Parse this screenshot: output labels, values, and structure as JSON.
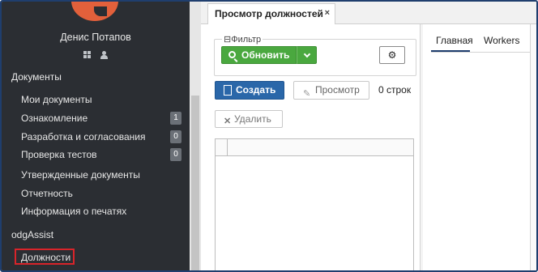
{
  "sidebar": {
    "user_name": "Денис Потапов",
    "icons": [
      "grid-icon",
      "person-icon"
    ],
    "documents_title": "Документы",
    "items": [
      {
        "label": "Мои документы",
        "badge": ""
      },
      {
        "label": "Ознакомление",
        "badge": "1"
      },
      {
        "label": "Разработка и согласования",
        "badge": "0"
      },
      {
        "label": "Проверка тестов",
        "badge": "0"
      },
      {
        "label": "Утвержденные документы",
        "badge": ""
      },
      {
        "label": "Отчетность",
        "badge": ""
      },
      {
        "label": "Информация о печатях",
        "badge": ""
      }
    ],
    "odg_title": "odgAssist",
    "odg_items": [
      {
        "label": "Должности",
        "highlighted": true
      }
    ]
  },
  "tabs": {
    "active_label": "Просмотр должностей",
    "close_glyph": "×"
  },
  "filter": {
    "legend": "Фильтр",
    "collapse_glyph": "⊟",
    "refresh_label": "Обновить",
    "settings_glyph": "⚙"
  },
  "toolbar": {
    "create_label": "Создать",
    "view_label": "Просмотр",
    "count_text": "0 строк",
    "delete_label": "Удалить"
  },
  "right_pane": {
    "tabs": [
      "Главная",
      "Workers"
    ]
  },
  "colors": {
    "sidebar_bg": "#2b2e33",
    "accent_green": "#4aa83f",
    "accent_blue": "#2a67a9",
    "logo_orange": "#e2603b",
    "highlight_red": "#d8242a"
  }
}
